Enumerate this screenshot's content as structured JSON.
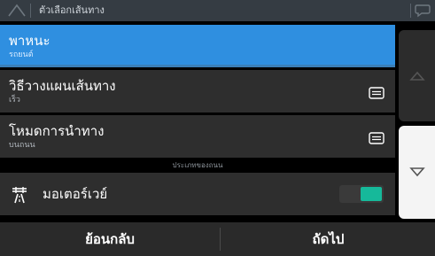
{
  "header": {
    "title": "ตัวเลือกเส้นทาง",
    "left_icon": "navigation-arrow-icon",
    "right_icon": "speech-bubble-icon"
  },
  "list": {
    "rows": [
      {
        "title": "พาหนะ",
        "subtitle": "รถยนต์",
        "selected": true
      },
      {
        "title": "วิธีวางแผนเส้นทาง",
        "subtitle": "เร็ว",
        "icon": "list-icon"
      },
      {
        "title": "โหมดการนำทาง",
        "subtitle": "บนถนน",
        "icon": "list-icon"
      }
    ],
    "section_label": "ประเภทของถนน",
    "toggle": {
      "label": "มอเตอร์เวย์",
      "icon": "motorway-icon",
      "on": true
    }
  },
  "scroll": {
    "up_icon": "chevron-up-icon",
    "down_icon": "chevron-down-icon"
  },
  "footer": {
    "back_label": "ย้อนกลับ",
    "next_label": "ถัดไป"
  },
  "colors": {
    "accent": "#2f8fe0",
    "toggle_on": "#16b99a",
    "header_bg": "#353c43"
  }
}
